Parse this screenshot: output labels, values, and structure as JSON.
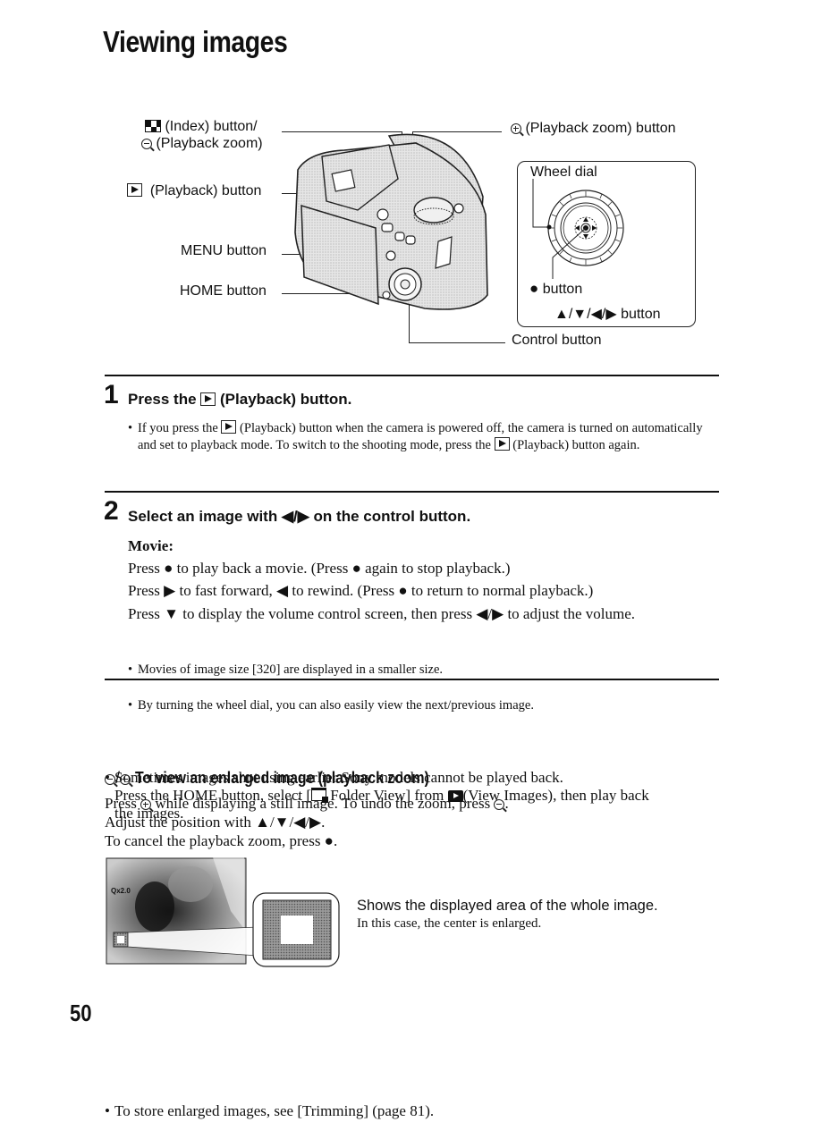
{
  "page": {
    "title": "Viewing images",
    "page_number": "50"
  },
  "diagram": {
    "index_button_label": "(Index) button/",
    "zoom_out_label": "(Playback zoom)",
    "playback_button_label": "(Playback) button",
    "menu_button_label": "MENU button",
    "home_button_label": "HOME button",
    "zoom_in_label": "(Playback zoom) button",
    "control_button_label": "Control button",
    "inset": {
      "wheel_dial_label": "Wheel dial",
      "center_button_label": "button",
      "arrows_label": "▲/▼/◀/▶ button"
    }
  },
  "step1": {
    "number": "1",
    "heading_pre": "Press the",
    "heading_post": "(Playback) button.",
    "note_a": "If you press the",
    "note_b": "(Playback) button when the camera is powered off, the camera is turned on automatically and set to playback mode. To switch to the shooting mode, press the",
    "note_c": "(Playback) button again."
  },
  "step2": {
    "number": "2",
    "heading": "Select an image with ◀/▶ on the control button.",
    "movie_label": "Movie:",
    "lines": [
      "Press ● to play back a movie. (Press ● again to stop playback.)",
      "Press ▶ to fast forward, ◀ to rewind. (Press ● to return to normal playback.)",
      "Press ▼ to display the volume control screen, then press ◀/▶ to adjust the volume."
    ],
    "bullets": [
      "Movies of image size [320] are displayed in a smaller size.",
      "By turning the wheel dial, you can also easily view the next/previous image."
    ]
  },
  "notes": {
    "sony_line1": "Sometimes images shot using earlier Sony models cannot be played back.",
    "sony_line2_a": "Press the HOME button, select [",
    "sony_line2_b": "Folder View] from",
    "sony_line2_c": "(View Images), then play back",
    "sony_line3": "the images."
  },
  "zoom_section": {
    "heading": "To view an enlarged image (playback zoom)",
    "line1_a": "Press",
    "line1_b": "while displaying a still image. To undo the zoom, press",
    "line1_c": ".",
    "line2": "Adjust the position with ▲/▼/◀/▶.",
    "line3": "To cancel the playback zoom, press ●.",
    "screen_zoom_readout": "x2.0",
    "caption_main": "Shows the displayed area of the whole image.",
    "caption_sub": "In this case, the center is enlarged.",
    "trimming_note": "To store enlarged images, see [Trimming] (page 81)."
  }
}
